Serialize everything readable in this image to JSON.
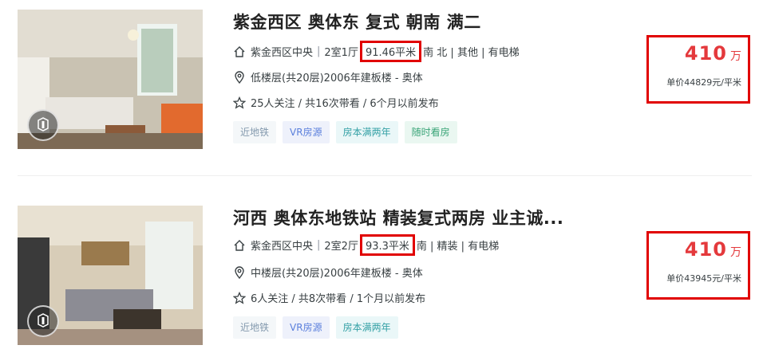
{
  "listings": [
    {
      "title": "紫金西区 奥体东 复式 朝南 满二",
      "community": "紫金西区中央",
      "layout": "2室1厅",
      "area": "91.46平米",
      "details": "南 北 | 其他 | 有电梯",
      "floor_info": "低楼层(共20层)2006年建板楼 - 奥体",
      "follow_info": "25人关注 / 共16次带看 / 6个月以前发布",
      "tags": [
        "近地铁",
        "VR房源",
        "房本满两年",
        "随时看房"
      ],
      "total_price": "410",
      "total_unit": "万",
      "unit_price": "单价44829元/平米"
    },
    {
      "title": "河西 奥体东地铁站 精装复式两房 业主诚...",
      "community": "紫金西区中央",
      "layout": "2室2厅",
      "area": "93.3平米",
      "details": "南 | 精装 | 有电梯",
      "floor_info": "中楼层(共20层)2006年建板楼 - 奥体",
      "follow_info": "6人关注 / 共8次带看 / 1个月以前发布",
      "tags": [
        "近地铁",
        "VR房源",
        "房本满两年"
      ],
      "total_price": "410",
      "total_unit": "万",
      "unit_price": "单价43945元/平米"
    }
  ],
  "separator": "|",
  "icons": {
    "house": "house-icon",
    "location": "location-pin-icon",
    "follow": "star-icon",
    "vr_badge": "vr-badge-icon"
  },
  "colors": {
    "price_red": "#e4393c",
    "highlight_box": "#e10000"
  }
}
